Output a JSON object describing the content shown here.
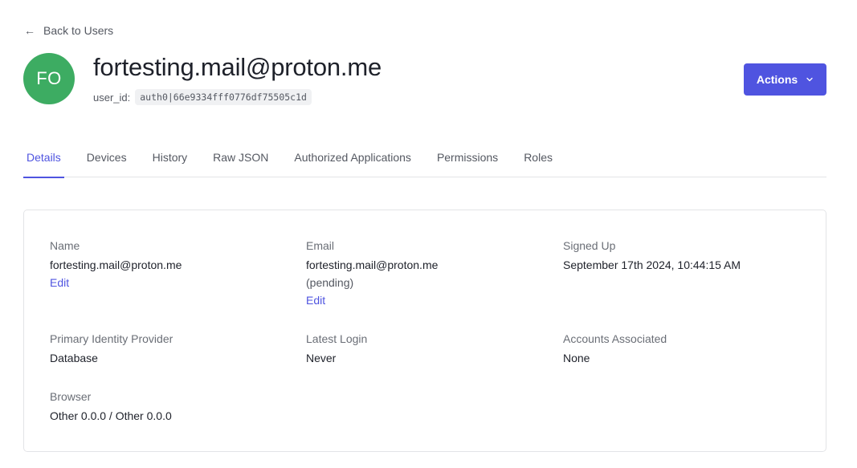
{
  "nav": {
    "back_label": "Back to Users",
    "back_icon": "arrow-left-icon"
  },
  "header": {
    "avatar_initials": "FO",
    "avatar_color": "#3dac62",
    "title": "fortesting.mail@proton.me",
    "user_id_label": "user_id:",
    "user_id_value": "auth0|66e9334fff0776df75505c1d",
    "actions_label": "Actions",
    "actions_icon": "chevron-down-icon",
    "accent_color": "#4f54e0"
  },
  "tabs": [
    {
      "label": "Details",
      "active": true
    },
    {
      "label": "Devices",
      "active": false
    },
    {
      "label": "History",
      "active": false
    },
    {
      "label": "Raw JSON",
      "active": false
    },
    {
      "label": "Authorized Applications",
      "active": false
    },
    {
      "label": "Permissions",
      "active": false
    },
    {
      "label": "Roles",
      "active": false
    }
  ],
  "details": {
    "name": {
      "label": "Name",
      "value": "fortesting.mail@proton.me",
      "edit_label": "Edit"
    },
    "email": {
      "label": "Email",
      "value": "fortesting.mail@proton.me",
      "status": "(pending)",
      "edit_label": "Edit"
    },
    "signed_up": {
      "label": "Signed Up",
      "value": "September 17th 2024, 10:44:15 AM"
    },
    "identity_provider": {
      "label": "Primary Identity Provider",
      "value": "Database"
    },
    "latest_login": {
      "label": "Latest Login",
      "value": "Never"
    },
    "accounts_associated": {
      "label": "Accounts Associated",
      "value": "None"
    },
    "browser": {
      "label": "Browser",
      "value": "Other 0.0.0 / Other 0.0.0"
    }
  }
}
